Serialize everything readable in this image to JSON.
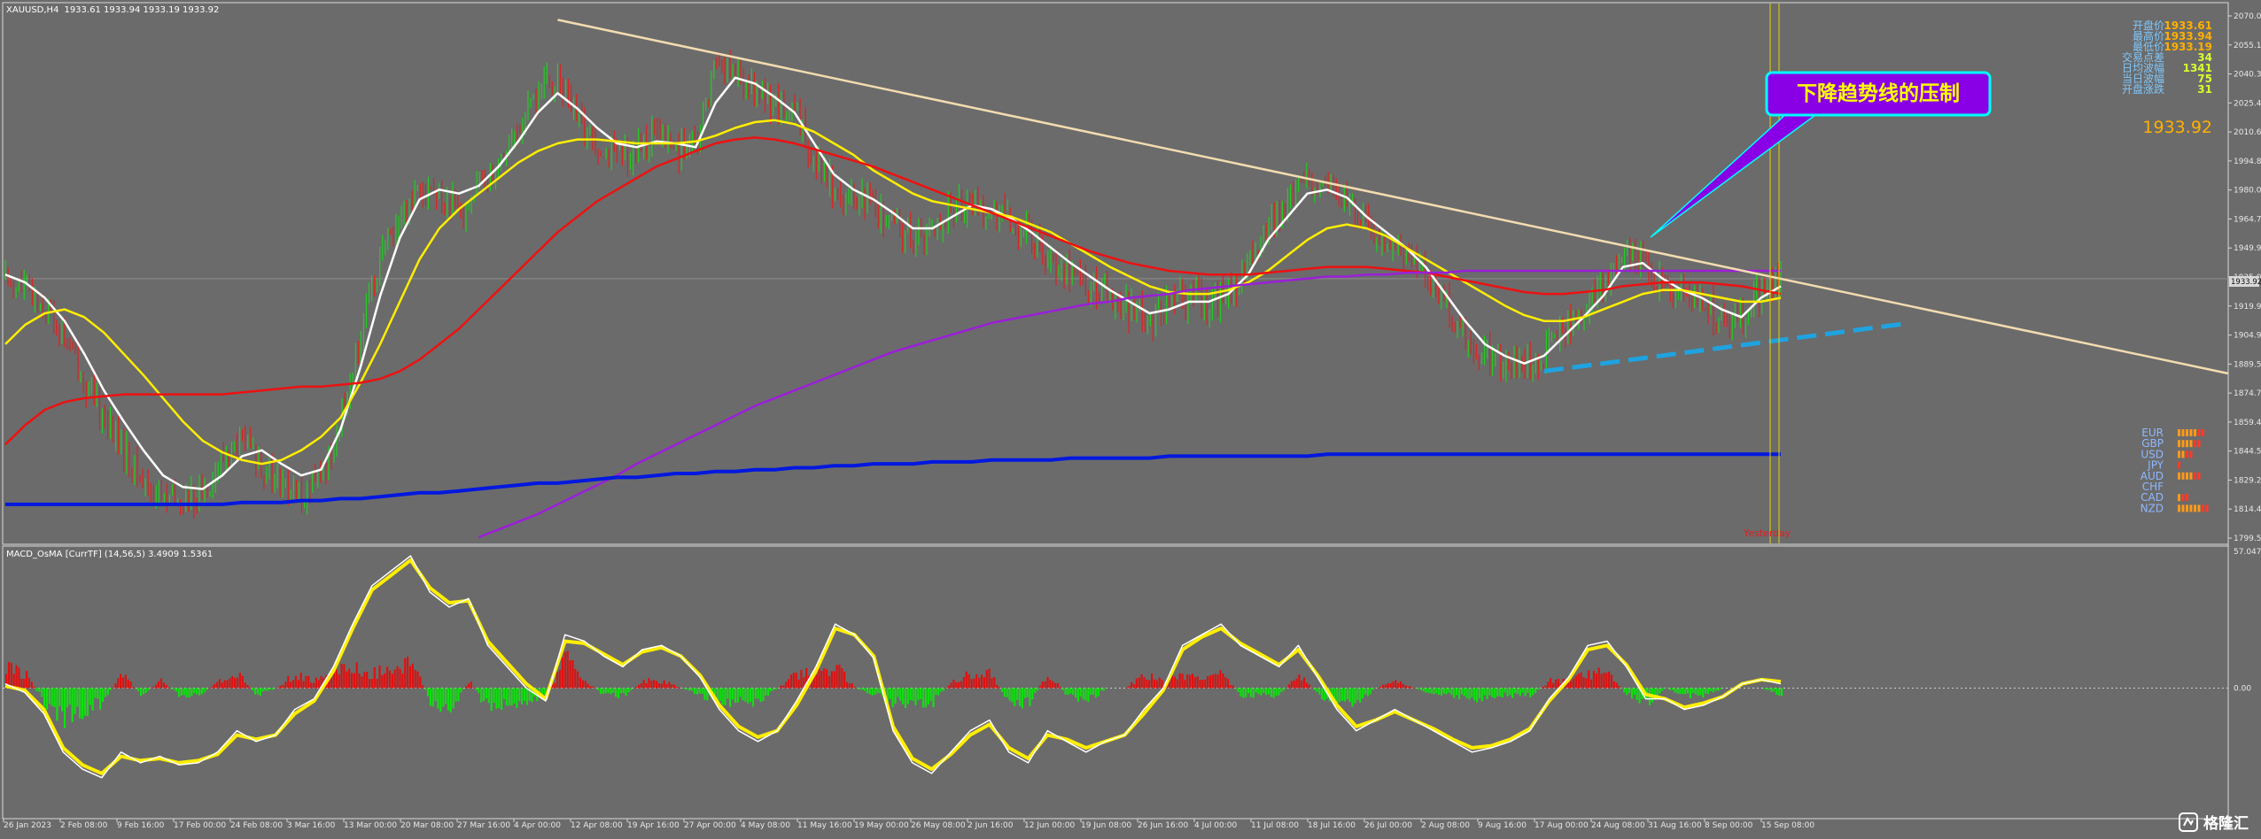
{
  "window": {
    "header_symbol": "XAUUSD,H4",
    "header_ohlc": "1933.61 1933.94 1933.19 1933.92",
    "macd_header": "MACD_OsMA [CurrTF] (14,56,5) 3.4909 1.5361"
  },
  "info_panel": {
    "rows": [
      {
        "label": "开盘价",
        "value": "1933.61",
        "tone": "orange"
      },
      {
        "label": "最高价",
        "value": "1933.94",
        "tone": "orange"
      },
      {
        "label": "最低价",
        "value": "1933.19",
        "tone": "orange"
      },
      {
        "label": "交易点差",
        "value": "34",
        "tone": "green"
      },
      {
        "label": "日均波幅",
        "value": "1341",
        "tone": "green"
      },
      {
        "label": "当日波幅",
        "value": "75",
        "tone": "green"
      },
      {
        "label": "开盘涨跌",
        "value": "31",
        "tone": "green"
      }
    ],
    "big_price": "1933.92"
  },
  "annotation": {
    "callout_text": "下降趋势线的压制",
    "yesterday_label": "Yesterday"
  },
  "currency_strength": [
    {
      "code": "EUR",
      "bars": 7
    },
    {
      "code": "GBP",
      "bars": 6
    },
    {
      "code": "USD",
      "bars": 4
    },
    {
      "code": "JPY",
      "bars": 1
    },
    {
      "code": "AUD",
      "bars": 6
    },
    {
      "code": "CHF",
      "bars": 0
    },
    {
      "code": "CAD",
      "bars": 3
    },
    {
      "code": "NZD",
      "bars": 8
    }
  ],
  "watermark": {
    "logo_text": "格隆汇"
  },
  "colors": {
    "background": "#6b6b6b",
    "bull_candle": "#22cc22",
    "bear_candle": "#dd2222",
    "ma_white": "#ffffff",
    "ma_yellow": "#ffee00",
    "ma_red": "#ee1111",
    "ma_purple": "#9b1fd8",
    "ma_blue": "#0018e0",
    "trendline": "#f2dcb0",
    "support_dash": "#1fa3e0",
    "callout_fill": "#8a00e6",
    "callout_border": "#00ffff",
    "callout_text": "#ffff00"
  },
  "chart_data": [
    {
      "type": "candlestick",
      "title": "",
      "y_axis_ticks": [
        "2070.00",
        "2055.15",
        "2040.30",
        "2025.45",
        "2010.60",
        "1994.85",
        "1980.00",
        "1964.75",
        "1949.90",
        "1935.05",
        "1919.95",
        "1904.95",
        "1889.55",
        "1874.70",
        "1859.40",
        "1844.55",
        "1829.25",
        "1814.40",
        "1799.55"
      ],
      "ylim": [
        1799.55,
        2070.0
      ],
      "current_price": "1933.92",
      "x_axis_ticks": [
        "26 Jan 2023",
        "2 Feb 08:00",
        "9 Feb 16:00",
        "17 Feb 00:00",
        "24 Feb 08:00",
        "3 Mar 16:00",
        "13 Mar 00:00",
        "20 Mar 08:00",
        "27 Mar 16:00",
        "4 Apr 00:00",
        "12 Apr 08:00",
        "19 Apr 16:00",
        "27 Apr 00:00",
        "4 May 08:00",
        "11 May 16:00",
        "19 May 00:00",
        "26 May 08:00",
        "2 Jun 16:00",
        "12 Jun 00:00",
        "19 Jun 08:00",
        "26 Jun 16:00",
        "4 Jul 00:00",
        "11 Jul 08:00",
        "18 Jul 16:00",
        "26 Jul 00:00",
        "2 Aug 08:00",
        "9 Aug 16:00",
        "17 Aug 00:00",
        "24 Aug 08:00",
        "31 Aug 16:00",
        "8 Sep 00:00",
        "15 Sep 08:00"
      ],
      "price_path": [
        1935,
        1928,
        1920,
        1905,
        1880,
        1862,
        1845,
        1828,
        1820,
        1818,
        1822,
        1840,
        1850,
        1838,
        1826,
        1822,
        1830,
        1860,
        1905,
        1945,
        1965,
        1985,
        1975,
        1968,
        1982,
        1995,
        2010,
        2030,
        2038,
        2015,
        2005,
        1998,
        2000,
        2008,
        2002,
        2000,
        2048,
        2040,
        2030,
        2025,
        2018,
        1998,
        1980,
        1975,
        1972,
        1962,
        1955,
        1958,
        1970,
        1975,
        1968,
        1962,
        1955,
        1945,
        1938,
        1930,
        1925,
        1918,
        1912,
        1920,
        1925,
        1920,
        1928,
        1940,
        1960,
        1972,
        1985,
        1980,
        1975,
        1962,
        1955,
        1948,
        1938,
        1920,
        1905,
        1895,
        1890,
        1888,
        1895,
        1908,
        1918,
        1930,
        1948,
        1942,
        1930,
        1925,
        1922,
        1915,
        1912,
        1928,
        1934
      ],
      "series": [
        {
          "name": "",
          "color_key": "ma_white",
          "values": [
            1936,
            1932,
            1924,
            1912,
            1895,
            1876,
            1860,
            1845,
            1832,
            1826,
            1825,
            1832,
            1842,
            1845,
            1838,
            1832,
            1835,
            1856,
            1888,
            1925,
            1955,
            1975,
            1980,
            1978,
            1982,
            1992,
            2005,
            2020,
            2030,
            2022,
            2012,
            2004,
            2002,
            2005,
            2004,
            2002,
            2025,
            2038,
            2035,
            2028,
            2020,
            2004,
            1988,
            1980,
            1975,
            1968,
            1960,
            1960,
            1966,
            1972,
            1970,
            1965,
            1958,
            1950,
            1942,
            1935,
            1928,
            1922,
            1916,
            1918,
            1922,
            1922,
            1926,
            1936,
            1954,
            1966,
            1978,
            1980,
            1976,
            1966,
            1958,
            1950,
            1940,
            1926,
            1912,
            1900,
            1894,
            1890,
            1894,
            1904,
            1914,
            1925,
            1940,
            1942,
            1934,
            1928,
            1924,
            1918,
            1914,
            1924,
            1930
          ]
        },
        {
          "name": "",
          "color_key": "ma_yellow",
          "values": [
            1900,
            1910,
            1916,
            1918,
            1914,
            1906,
            1895,
            1884,
            1872,
            1860,
            1850,
            1844,
            1840,
            1838,
            1840,
            1845,
            1852,
            1862,
            1880,
            1900,
            1922,
            1944,
            1960,
            1970,
            1978,
            1986,
            1994,
            2000,
            2004,
            2006,
            2006,
            2005,
            2004,
            2004,
            2004,
            2005,
            2008,
            2012,
            2015,
            2016,
            2014,
            2010,
            2004,
            1998,
            1990,
            1984,
            1978,
            1974,
            1972,
            1970,
            1968,
            1966,
            1962,
            1958,
            1952,
            1946,
            1940,
            1935,
            1930,
            1927,
            1926,
            1926,
            1928,
            1932,
            1938,
            1946,
            1954,
            1960,
            1962,
            1960,
            1956,
            1950,
            1944,
            1938,
            1932,
            1926,
            1920,
            1915,
            1912,
            1912,
            1914,
            1918,
            1922,
            1926,
            1928,
            1928,
            1926,
            1924,
            1922,
            1922,
            1924
          ]
        },
        {
          "name": "",
          "color_key": "ma_red",
          "values": [
            1848,
            1858,
            1866,
            1870,
            1872,
            1873,
            1874,
            1874,
            1874,
            1874,
            1874,
            1874,
            1875,
            1876,
            1877,
            1878,
            1878,
            1879,
            1880,
            1882,
            1886,
            1892,
            1900,
            1908,
            1918,
            1928,
            1938,
            1948,
            1958,
            1966,
            1974,
            1980,
            1986,
            1992,
            1996,
            2000,
            2004,
            2006,
            2007,
            2006,
            2004,
            2001,
            1998,
            1995,
            1992,
            1988,
            1984,
            1980,
            1976,
            1972,
            1968,
            1964,
            1960,
            1956,
            1952,
            1948,
            1945,
            1942,
            1940,
            1938,
            1937,
            1936,
            1936,
            1936,
            1937,
            1938,
            1939,
            1940,
            1940,
            1940,
            1939,
            1938,
            1937,
            1935,
            1933,
            1931,
            1929,
            1927,
            1926,
            1926,
            1927,
            1928,
            1930,
            1931,
            1932,
            1932,
            1932,
            1931,
            1930,
            1928,
            1926
          ]
        },
        {
          "name": "",
          "color_key": "ma_purple",
          "values": [
            null,
            null,
            null,
            null,
            null,
            null,
            null,
            null,
            null,
            null,
            null,
            null,
            null,
            null,
            null,
            null,
            null,
            null,
            null,
            null,
            null,
            null,
            null,
            null,
            1800,
            1804,
            1808,
            1812,
            1817,
            1822,
            1827,
            1832,
            1838,
            1843,
            1848,
            1853,
            1858,
            1863,
            1868,
            1872,
            1876,
            1880,
            1884,
            1888,
            1892,
            1896,
            1899,
            1902,
            1905,
            1908,
            1911,
            1913,
            1915,
            1917,
            1919,
            1921,
            1922,
            1924,
            1925,
            1926,
            1928,
            1929,
            1930,
            1931,
            1932,
            1933,
            1934,
            1935,
            1935,
            1936,
            1936,
            1937,
            1937,
            1937,
            1938,
            1938,
            1938,
            1938,
            1938,
            1938,
            1938,
            1938,
            1938,
            1938,
            1938,
            1938,
            1938,
            1938,
            1938,
            1938,
            1938
          ]
        },
        {
          "name": "",
          "color_key": "ma_blue",
          "values": [
            1817,
            1817,
            1817,
            1817,
            1817,
            1817,
            1817,
            1817,
            1817,
            1817,
            1817,
            1817,
            1818,
            1818,
            1818,
            1819,
            1819,
            1820,
            1820,
            1821,
            1822,
            1823,
            1823,
            1824,
            1825,
            1826,
            1827,
            1828,
            1828,
            1829,
            1830,
            1831,
            1831,
            1832,
            1833,
            1833,
            1834,
            1834,
            1835,
            1835,
            1836,
            1836,
            1837,
            1837,
            1838,
            1838,
            1838,
            1839,
            1839,
            1839,
            1840,
            1840,
            1840,
            1840,
            1841,
            1841,
            1841,
            1841,
            1841,
            1842,
            1842,
            1842,
            1842,
            1842,
            1842,
            1842,
            1842,
            1843,
            1843,
            1843,
            1843,
            1843,
            1843,
            1843,
            1843,
            1843,
            1843,
            1843,
            1843,
            1843,
            1843,
            1843,
            1843,
            1843,
            1843,
            1843,
            1843,
            1843,
            1843,
            1843,
            1843
          ]
        }
      ],
      "trendlines": [
        {
          "kind": "resistance",
          "from": {
            "xi": 28,
            "y": 2068
          },
          "to": {
            "xi": 90,
            "y": 1888
          }
        },
        {
          "kind": "support",
          "from": {
            "xi": 78,
            "y": 1886
          },
          "to": {
            "xi": 91,
            "y": 1910
          }
        }
      ]
    },
    {
      "type": "area",
      "title": "",
      "ylim": [
        -57.0471,
        57.0471
      ],
      "y_axis_ticks": [
        "57.0471",
        "0.00"
      ],
      "macd": [
        2,
        -2,
        -12,
        -30,
        -38,
        -42,
        -30,
        -35,
        -32,
        -36,
        -35,
        -30,
        -20,
        -25,
        -22,
        -10,
        -5,
        10,
        30,
        48,
        55,
        62,
        45,
        38,
        42,
        20,
        10,
        0,
        -6,
        25,
        22,
        15,
        10,
        18,
        20,
        15,
        5,
        -10,
        -20,
        -25,
        -20,
        -6,
        10,
        30,
        25,
        14,
        -20,
        -35,
        -40,
        -30,
        -20,
        -15,
        -30,
        -35,
        -20,
        -25,
        -30,
        -25,
        -22,
        -10,
        0,
        20,
        25,
        30,
        20,
        15,
        10,
        20,
        5,
        -10,
        -20,
        -15,
        -10,
        -15,
        -20,
        -25,
        -30,
        -28,
        -25,
        -20,
        -5,
        5,
        20,
        22,
        10,
        -5,
        -5,
        -10,
        -8,
        -4,
        2,
        4,
        2
      ],
      "signal": [
        1,
        -1,
        -10,
        -28,
        -36,
        -40,
        -32,
        -34,
        -33,
        -35,
        -34,
        -31,
        -22,
        -24,
        -22,
        -12,
        -6,
        8,
        28,
        46,
        53,
        60,
        47,
        40,
        41,
        22,
        12,
        2,
        -5,
        22,
        21,
        16,
        11,
        17,
        19,
        15,
        6,
        -8,
        -18,
        -23,
        -20,
        -8,
        8,
        28,
        25,
        15,
        -18,
        -33,
        -38,
        -31,
        -22,
        -17,
        -28,
        -33,
        -22,
        -24,
        -28,
        -25,
        -22,
        -12,
        -1,
        18,
        24,
        28,
        21,
        16,
        11,
        18,
        6,
        -8,
        -18,
        -15,
        -11,
        -15,
        -19,
        -24,
        -28,
        -27,
        -24,
        -19,
        -6,
        4,
        18,
        20,
        11,
        -3,
        -5,
        -9,
        -7,
        -4,
        2,
        4,
        3
      ],
      "histogram": [
        3,
        2,
        -2,
        -4,
        -3,
        -2,
        2,
        -1,
        1,
        -1,
        -1,
        1,
        2,
        -1,
        0,
        2,
        1,
        2,
        3,
        2,
        3,
        4,
        -2,
        -3,
        1,
        -3,
        -2,
        -2,
        -1,
        4,
        1,
        -1,
        -1,
        1,
        1,
        0,
        -1,
        -2,
        -2,
        -2,
        0,
        2,
        2,
        3,
        0,
        -1,
        -2,
        -2,
        -2,
        1,
        2,
        2,
        -2,
        -2,
        2,
        -1,
        -2,
        0,
        0,
        2,
        1,
        2,
        1,
        2,
        -1,
        -1,
        -1,
        2,
        -1,
        -2,
        -2,
        0,
        1,
        0,
        -1,
        -1,
        -2,
        -1,
        -1,
        -1,
        1,
        1,
        2,
        2,
        -1,
        -2,
        0,
        -1,
        -1,
        0,
        0,
        0,
        -1
      ]
    }
  ]
}
